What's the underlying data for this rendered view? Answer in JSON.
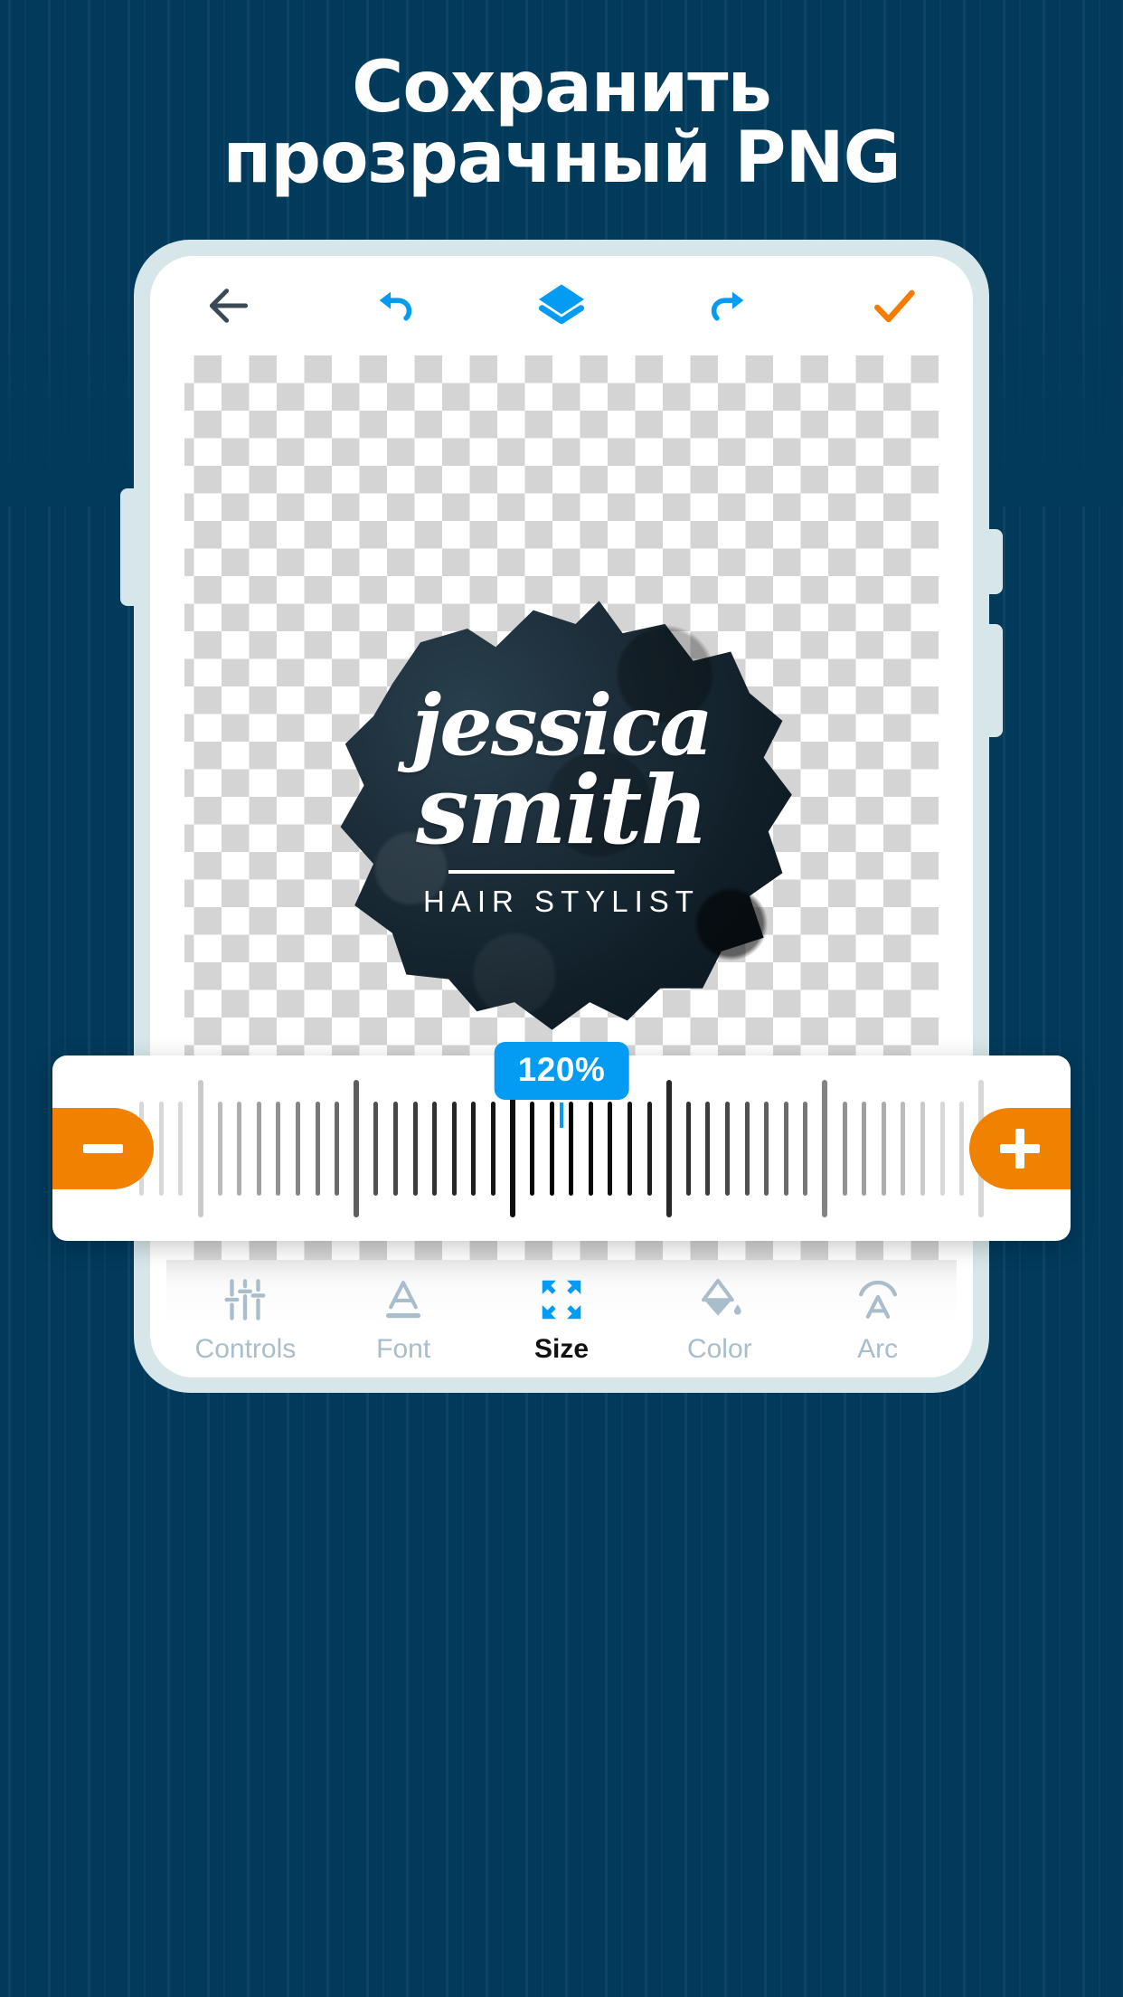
{
  "headline": {
    "line1": "Сохранить",
    "line2": "прозрачный PNG"
  },
  "colors": {
    "background_navy": "#013A5B",
    "accent_blue": "#049BF2",
    "accent_orange": "#F18100",
    "check_orange": "#F57C00",
    "tab_inactive": "#A9BDCB",
    "tab_active": "#111111",
    "phone_frame": "#D6E6E9"
  },
  "app_toolbar": {
    "items": [
      {
        "name": "back-icon",
        "label": "Back",
        "color": "#3A4A55"
      },
      {
        "name": "undo-icon",
        "label": "Undo",
        "color": "#049BF2"
      },
      {
        "name": "layers-icon",
        "label": "Layers",
        "color": "#049BF2"
      },
      {
        "name": "redo-icon",
        "label": "Redo",
        "color": "#049BF2"
      },
      {
        "name": "confirm-check-icon",
        "label": "Done",
        "color": "#F57C00"
      }
    ]
  },
  "canvas": {
    "background": "transparent-checkerboard",
    "logo": {
      "line1": "jessica",
      "line2": "smith",
      "subtitle": "HAIR STYLIST"
    }
  },
  "size_slider": {
    "value_label": "120%",
    "value_percent": 120,
    "minus_label": "−",
    "plus_label": "+",
    "minus_icon": "minus-icon",
    "plus_icon": "plus-icon"
  },
  "bottom_tabs": [
    {
      "label": "Controls",
      "icon": "sliders-icon",
      "active": false
    },
    {
      "label": "Font",
      "icon": "font-a-icon",
      "active": false
    },
    {
      "label": "Size",
      "icon": "resize-arrows-icon",
      "active": true
    },
    {
      "label": "Color",
      "icon": "paint-drop-icon",
      "active": false
    },
    {
      "label": "Arc",
      "icon": "arc-text-icon",
      "active": false
    }
  ]
}
